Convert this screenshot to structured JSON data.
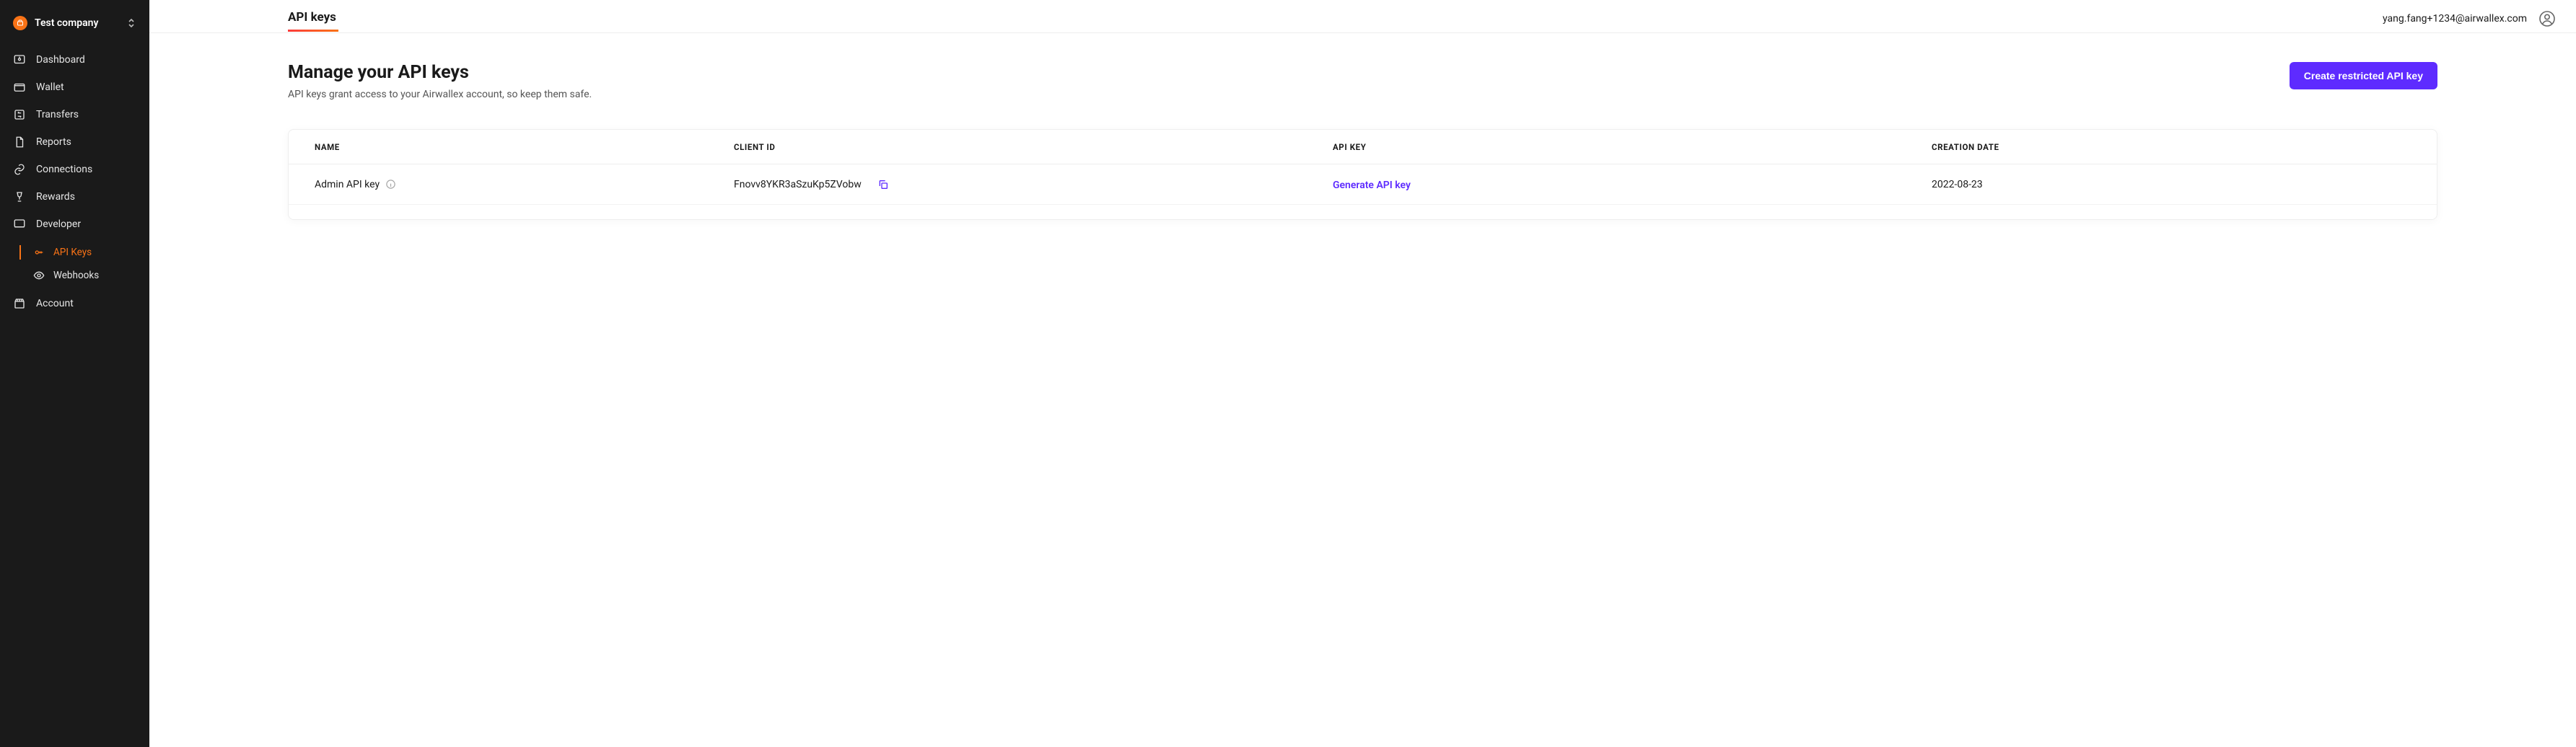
{
  "company": {
    "name": "Test company"
  },
  "sidebar": {
    "items": [
      {
        "label": "Dashboard"
      },
      {
        "label": "Wallet"
      },
      {
        "label": "Transfers"
      },
      {
        "label": "Reports"
      },
      {
        "label": "Connections"
      },
      {
        "label": "Rewards"
      },
      {
        "label": "Developer"
      },
      {
        "label": "Account"
      }
    ],
    "developer_sub": [
      {
        "label": "API Keys"
      },
      {
        "label": "Webhooks"
      }
    ]
  },
  "tabs": {
    "active": "API keys"
  },
  "user": {
    "email": "yang.fang+1234@airwallex.com"
  },
  "page": {
    "title": "Manage your API keys",
    "subtitle": "API keys grant access to your Airwallex account, so keep them safe.",
    "create_button": "Create restricted API key"
  },
  "table": {
    "headers": {
      "name": "NAME",
      "client": "CLIENT ID",
      "api": "API KEY",
      "date": "CREATION DATE"
    },
    "rows": [
      {
        "name": "Admin API key",
        "client_id": "Fnovv8YKR3aSzuKp5ZVobw",
        "api_link": "Generate API key",
        "date": "2022-08-23"
      }
    ]
  }
}
